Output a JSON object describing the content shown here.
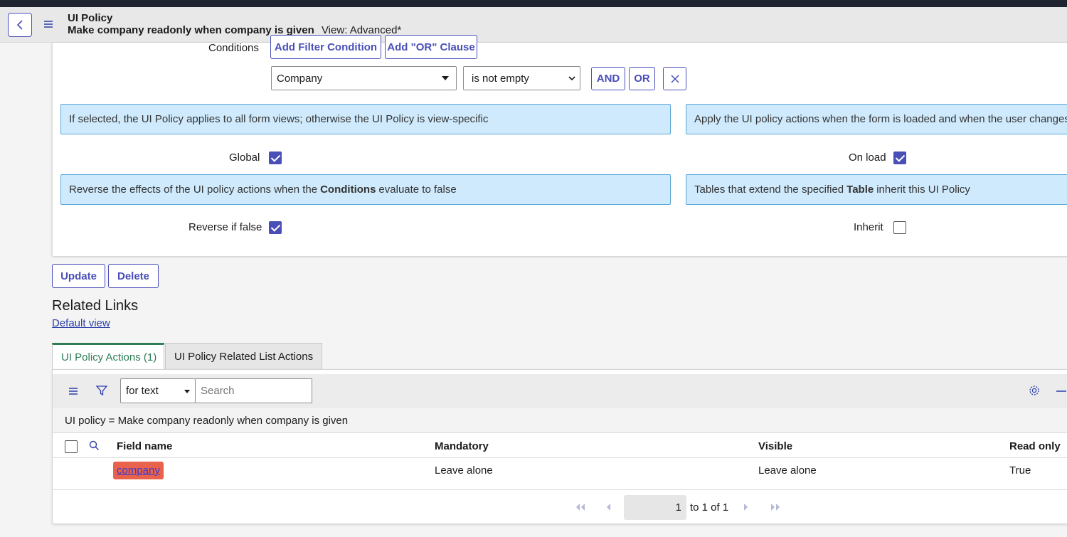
{
  "header": {
    "title": "UI Policy",
    "record": "Make company readonly when company is given",
    "view": "View: Advanced*"
  },
  "conditions": {
    "label": "Conditions",
    "add_filter": "Add Filter Condition",
    "add_or": "Add \"OR\" Clause",
    "field": "Company",
    "operator": "is not empty",
    "and_label": "AND",
    "or_label": "OR"
  },
  "info": {
    "global_hint": "If selected, the UI Policy applies to all form views; otherwise the UI Policy is view-specific",
    "onload_hint": "Apply the UI policy actions when the form is loaded and when the user changes",
    "reverse_hint_pre": "Reverse the effects of the UI policy actions when the",
    "reverse_hint_bold": "Conditions",
    "reverse_hint_post": "evaluate to false",
    "inherit_hint_pre": "Tables that extend the specified",
    "inherit_hint_bold": "Table",
    "inherit_hint_post": "inherit this UI Policy"
  },
  "fields": {
    "global_label": "Global",
    "global_checked": true,
    "onload_label": "On load",
    "onload_checked": true,
    "reverse_label": "Reverse if false",
    "reverse_checked": true,
    "inherit_label": "Inherit",
    "inherit_checked": false
  },
  "actions": {
    "update": "Update",
    "delete": "Delete"
  },
  "related_links": {
    "title": "Related Links",
    "default_view": "Default view"
  },
  "tabs": [
    {
      "label": "UI Policy Actions (1)",
      "active": true
    },
    {
      "label": "UI Policy Related List Actions",
      "active": false
    }
  ],
  "list": {
    "search_field": "for text",
    "search_placeholder": "Search",
    "filter_text": "UI policy = Make company readonly when company is given",
    "columns": [
      "Field name",
      "Mandatory",
      "Visible",
      "Read only"
    ],
    "rows": [
      {
        "field_name": "company",
        "mandatory": "Leave alone",
        "visible": "Leave alone",
        "read_only": "True"
      }
    ],
    "pager_value": "1",
    "pager_text": "to 1 of 1"
  },
  "colors": {
    "accent": "#4a4fb8",
    "info_bg": "#cfeafc",
    "info_border": "#5aa7d8",
    "tab_active": "#2e7d55",
    "field_highlight": "#e9624b"
  }
}
